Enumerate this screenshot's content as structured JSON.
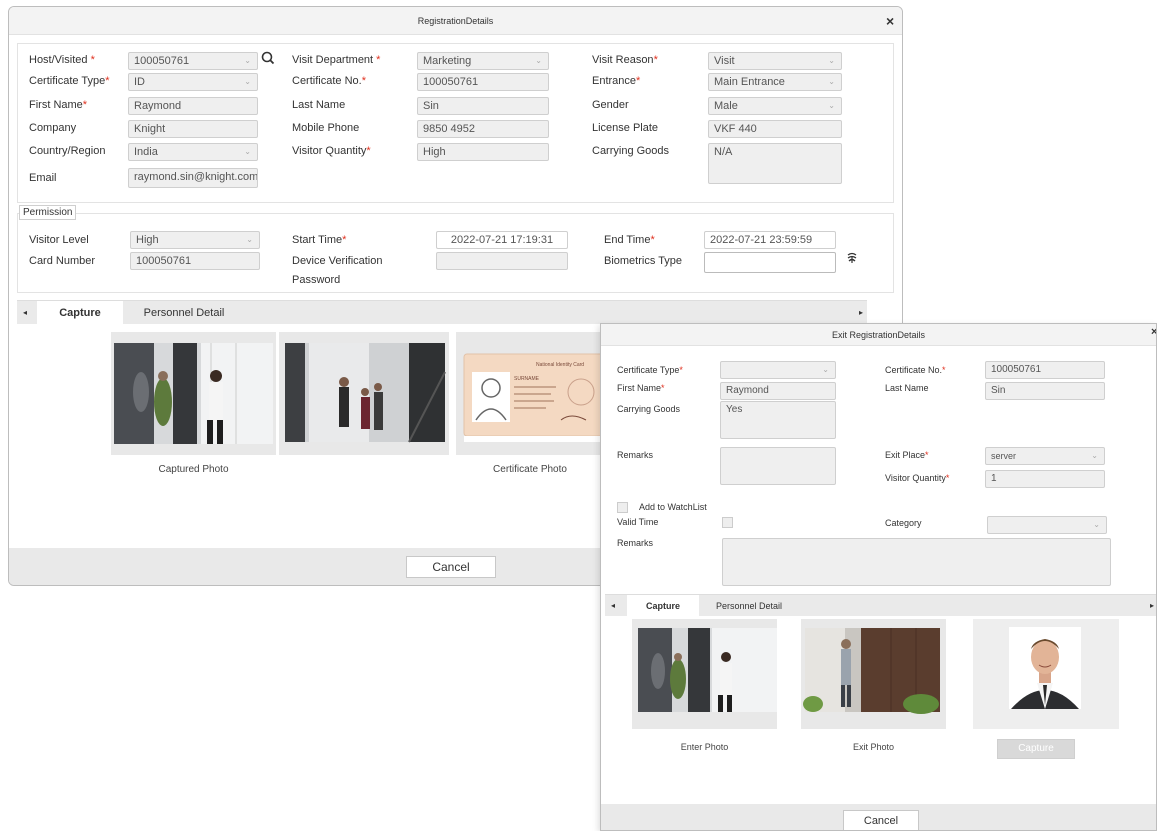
{
  "reg": {
    "title": "RegistrationDetails",
    "close": "×",
    "host_visited": {
      "label": "Host/Visited",
      "value": "100050761"
    },
    "visit_department": {
      "label": "Visit Department",
      "value": "Marketing"
    },
    "visit_reason": {
      "label": "Visit Reason",
      "value": "Visit"
    },
    "certificate_type": {
      "label": "Certificate Type",
      "value": "ID"
    },
    "certificate_no": {
      "label": "Certificate No.",
      "value": "100050761"
    },
    "entrance": {
      "label": "Entrance",
      "value": "Main Entrance"
    },
    "first_name": {
      "label": "First Name",
      "value": "Raymond"
    },
    "last_name": {
      "label": "Last Name",
      "value": "Sin"
    },
    "gender": {
      "label": "Gender",
      "value": "Male"
    },
    "company": {
      "label": "Company",
      "value": "Knight"
    },
    "mobile_phone": {
      "label": "Mobile Phone",
      "value": "9850 4952"
    },
    "license_plate": {
      "label": "License Plate",
      "value": "VKF 440"
    },
    "country_region": {
      "label": "Country/Region",
      "value": "India"
    },
    "visitor_quantity": {
      "label": "Visitor Quantity",
      "value": "High"
    },
    "carrying_goods": {
      "label": "Carrying Goods",
      "value": "N/A"
    },
    "email": {
      "label": "Email",
      "value": "raymond.sin@knight.com"
    },
    "permission_legend": "Permission",
    "visitor_level": {
      "label": "Visitor Level",
      "value": "High"
    },
    "start_time": {
      "label": "Start Time",
      "value": "2022-07-21  17:19:31"
    },
    "end_time": {
      "label": "End Time",
      "value": "2022-07-21  23:59:59"
    },
    "card_number": {
      "label": "Card Number",
      "value": "100050761"
    },
    "device_verification_line1": "Device Verification",
    "device_verification_line2": "Password",
    "biometrics_type": {
      "label": "Biometrics Type",
      "value": ""
    },
    "tabs": [
      "Capture",
      "Personnel Detail"
    ],
    "captured_photo": "Captured Photo",
    "certificate_photo": "Certificate Photo",
    "card_national": "National Identity Card",
    "card_surname": "SURNAME",
    "cancel": "Cancel"
  },
  "exit": {
    "title": "Exit RegistrationDetails",
    "close": "×",
    "certificate_type": {
      "label": "Certificate Type",
      "value": ""
    },
    "certificate_no": {
      "label": "Certificate No.",
      "value": "100050761"
    },
    "first_name": {
      "label": "First Name",
      "value": "Raymond"
    },
    "last_name": {
      "label": "Last Name",
      "value": "Sin"
    },
    "carrying_goods": {
      "label": "Carrying Goods",
      "value": "Yes"
    },
    "remarks": {
      "label": "Remarks",
      "value": ""
    },
    "exit_place": {
      "label": "Exit Place",
      "value": "server"
    },
    "visitor_quantity": {
      "label": "Visitor Quantity",
      "value": "1"
    },
    "add_to_watchlist": "Add to WatchList",
    "valid_time": "Valid Time",
    "category": {
      "label": "Category",
      "value": ""
    },
    "remarks2": {
      "label": "Remarks",
      "value": ""
    },
    "tabs": [
      "Capture",
      "Personnel Detail"
    ],
    "enter_photo": "Enter Photo",
    "exit_photo": "Exit Photo",
    "capture_button": "Capture",
    "cancel": "Cancel"
  },
  "icons": {
    "search": "search-icon",
    "biometrics": "fingerprint-icon",
    "dropdown": "chevron-down-icon",
    "left": "arrow-left-icon",
    "right": "arrow-right-icon"
  },
  "colors": {
    "required": "#e0301e",
    "field_bg": "#efefef",
    "footer_bg": "#e9e9e9"
  }
}
